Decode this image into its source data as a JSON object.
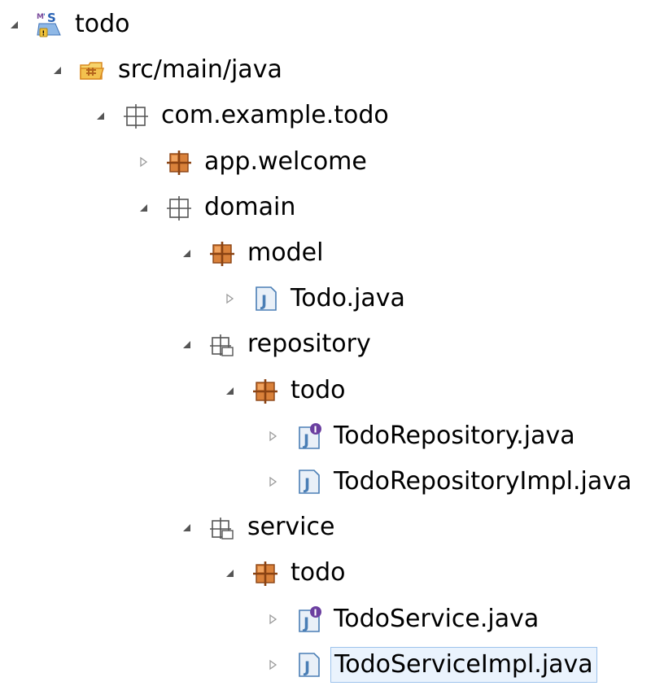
{
  "tree": {
    "items": [
      {
        "label": "todo",
        "expanded": true,
        "icon": "maven-project-icon",
        "level": 0,
        "selected": false
      },
      {
        "label": "src/main/java",
        "expanded": true,
        "icon": "source-folder-icon",
        "level": 1,
        "selected": false
      },
      {
        "label": "com.example.todo",
        "expanded": true,
        "icon": "empty-package-icon",
        "level": 2,
        "selected": false
      },
      {
        "label": "app.welcome",
        "expanded": false,
        "icon": "package-icon",
        "level": 3,
        "selected": false
      },
      {
        "label": "domain",
        "expanded": true,
        "icon": "empty-package-icon",
        "level": 3,
        "selected": false
      },
      {
        "label": "model",
        "expanded": true,
        "icon": "package-icon",
        "level": 4,
        "selected": false
      },
      {
        "label": "Todo.java",
        "expanded": false,
        "icon": "java-file-icon",
        "level": 5,
        "selected": false
      },
      {
        "label": "repository",
        "expanded": true,
        "icon": "package-folder-icon",
        "level": 4,
        "selected": false
      },
      {
        "label": "todo",
        "expanded": true,
        "icon": "package-icon",
        "level": 5,
        "selected": false
      },
      {
        "label": "TodoRepository.java",
        "expanded": false,
        "icon": "java-interface-icon",
        "level": 6,
        "selected": false
      },
      {
        "label": "TodoRepositoryImpl.java",
        "expanded": false,
        "icon": "java-file-icon",
        "level": 6,
        "selected": false
      },
      {
        "label": "service",
        "expanded": true,
        "icon": "package-folder-icon",
        "level": 4,
        "selected": false
      },
      {
        "label": "todo",
        "expanded": true,
        "icon": "package-icon",
        "level": 5,
        "selected": false
      },
      {
        "label": "TodoService.java",
        "expanded": false,
        "icon": "java-interface-icon",
        "level": 6,
        "selected": false
      },
      {
        "label": "TodoServiceImpl.java",
        "expanded": false,
        "icon": "java-file-icon",
        "level": 6,
        "selected": true
      }
    ]
  },
  "colors": {
    "text": "#000000",
    "package": "#b5651d",
    "java_blue": "#4a7eb5",
    "java_fill": "#e9f0f8",
    "interface_purple": "#6b3fa0",
    "selection_bg": "#eaf3fd",
    "selection_border": "#9dc3ec",
    "folder_orange": "#d98a21",
    "folder_yellow": "#f6d36b",
    "empty_package": "#555555",
    "arrow": "#555555"
  }
}
